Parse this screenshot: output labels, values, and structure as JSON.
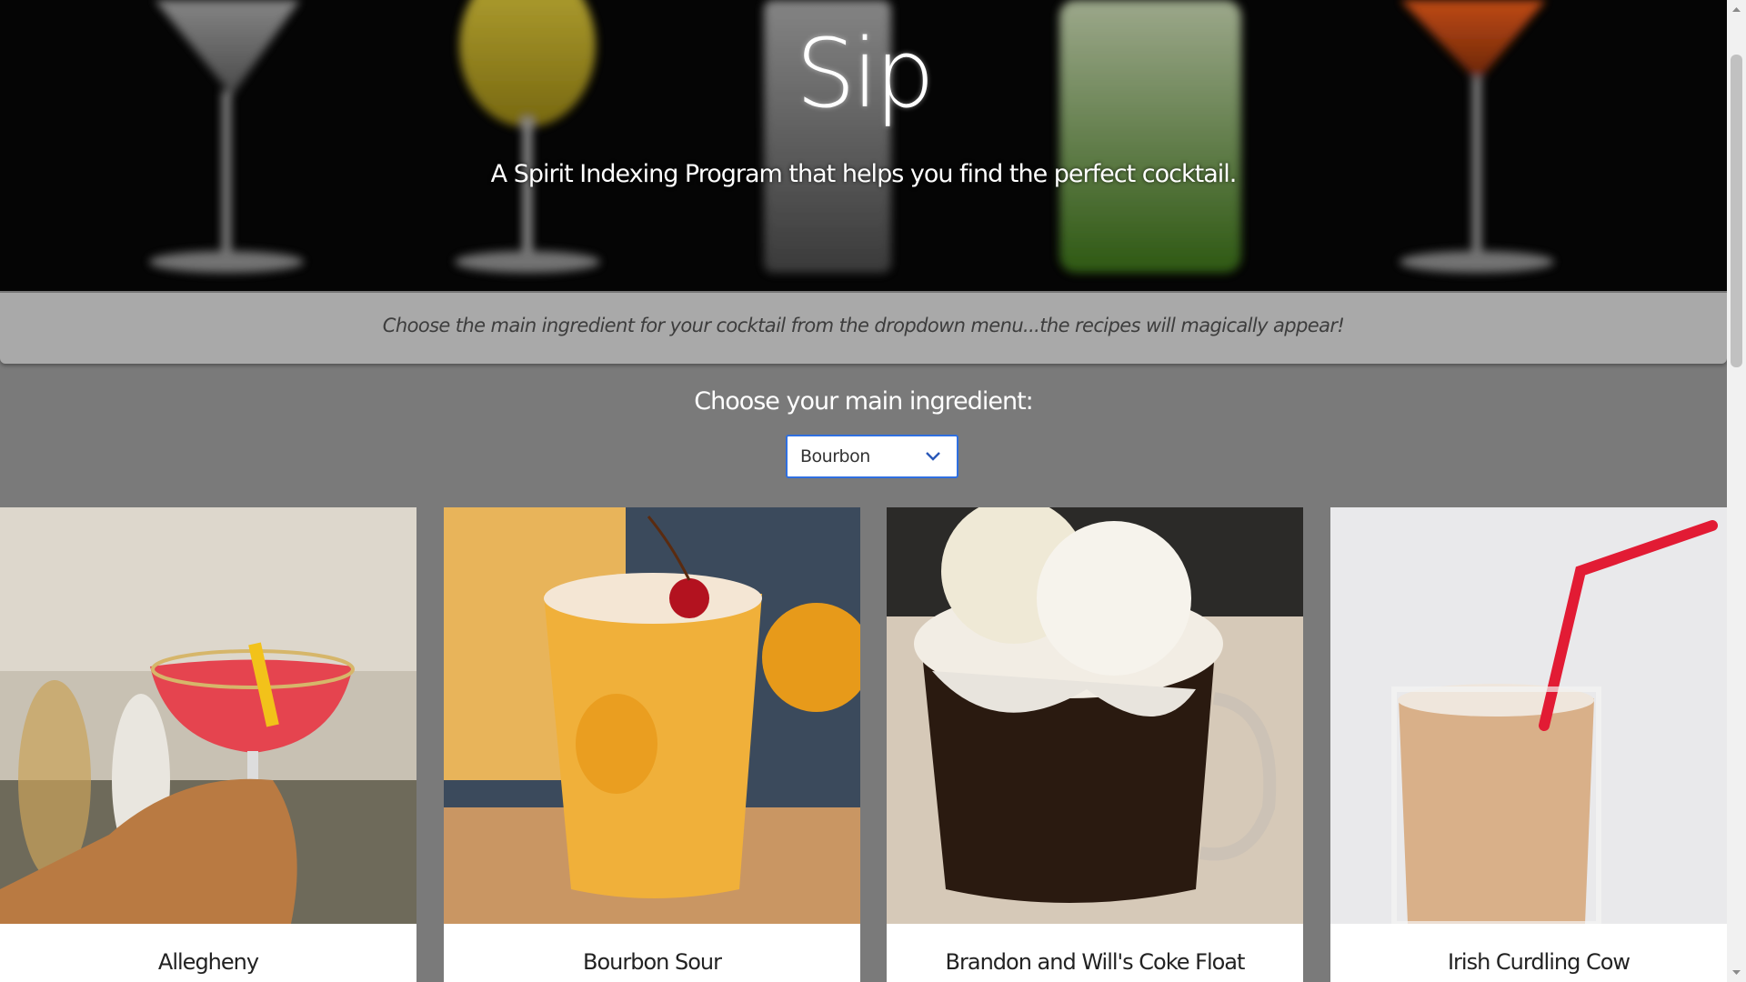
{
  "hero": {
    "title": "Sip",
    "subtitle": "A Spirit Indexing Program that helps you find the perfect cocktail."
  },
  "banner": {
    "text": "Choose the main ingredient for your cocktail from the dropdown menu...the recipes will magically appear!"
  },
  "chooser": {
    "label": "Choose your main ingredient:",
    "selected": "Bourbon",
    "accent": "#2f6fe0"
  },
  "cards": [
    {
      "name": "Allegheny",
      "image": "red cocktail in coupe glass"
    },
    {
      "name": "Bourbon Sour",
      "image": "amber sour with cherry"
    },
    {
      "name": "Brandon and Will's Coke Float",
      "image": "cola float with ice cream"
    },
    {
      "name": "Irish Curdling Cow",
      "image": "creamy drink with red straw"
    }
  ]
}
